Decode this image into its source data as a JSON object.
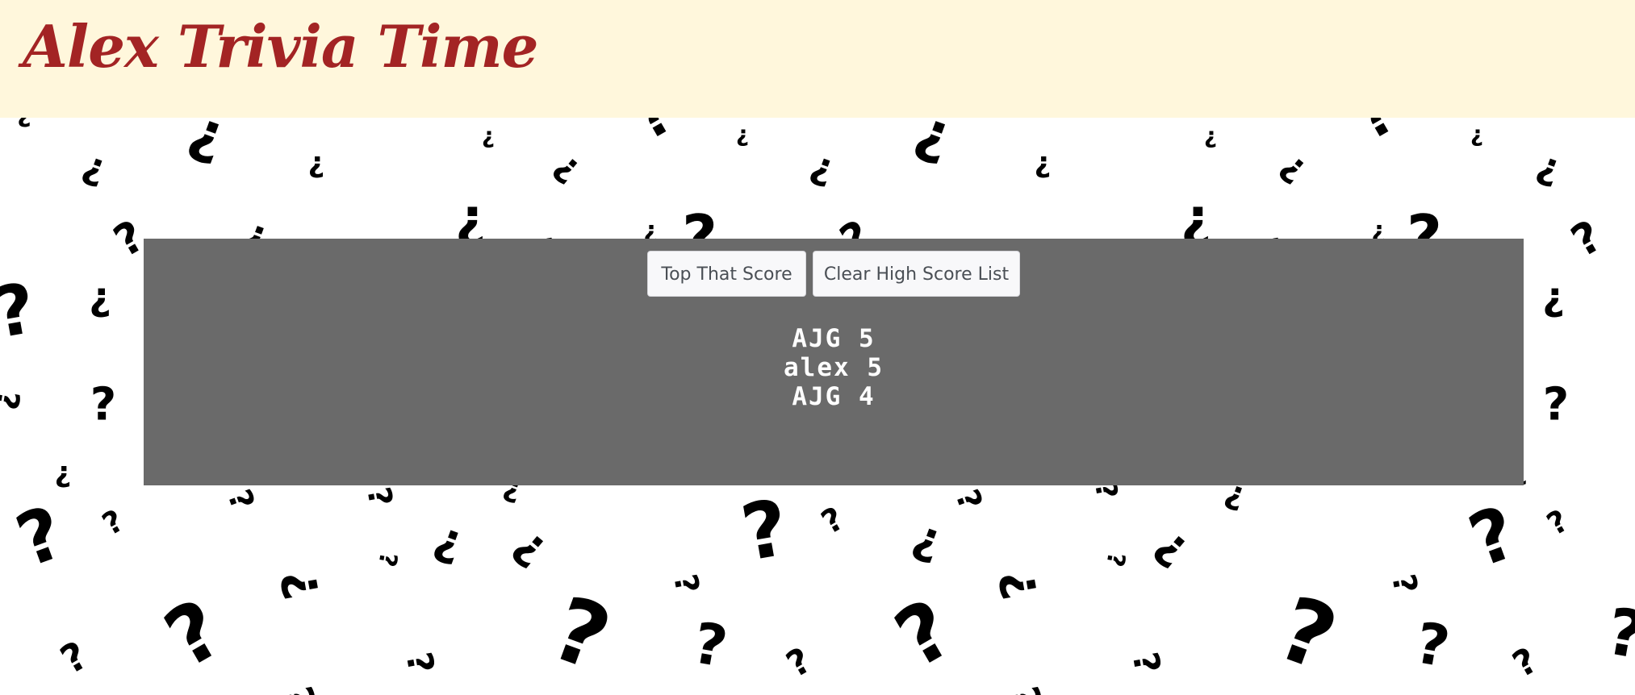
{
  "header": {
    "title": "Alex Trivia Time",
    "background_color": "#fff7dc",
    "title_color": "#a32424"
  },
  "background": {
    "pattern_icon": "question-mark-icon",
    "pattern_color": "#000000"
  },
  "panel": {
    "background_color": "#6a6a6a",
    "buttons": {
      "top_score_label": "Top That Score",
      "clear_label": "Clear High Score List"
    },
    "scores": [
      {
        "name": "AJG",
        "score": "5",
        "text": "AJG 5"
      },
      {
        "name": "alex",
        "score": "5",
        "text": "alex 5"
      },
      {
        "name": "AJG",
        "score": "4",
        "text": "AJG 4"
      }
    ]
  }
}
